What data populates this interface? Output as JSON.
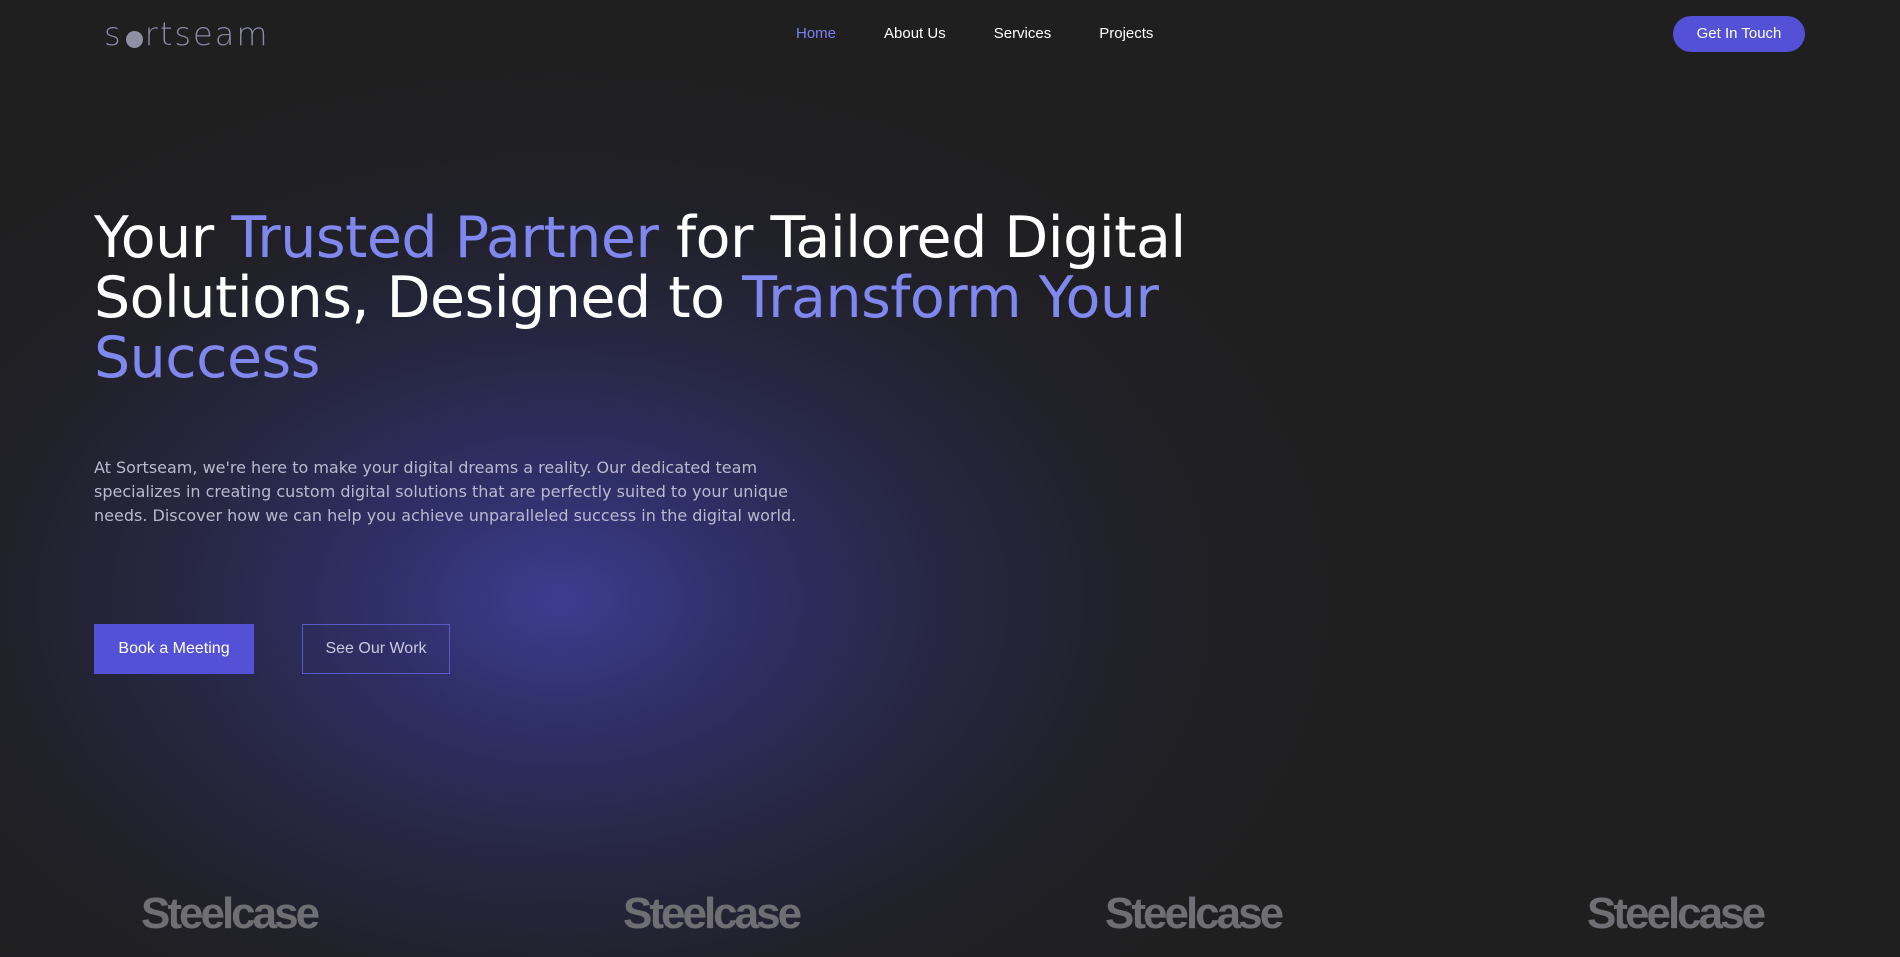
{
  "brand": {
    "logo_prefix": "s",
    "logo_suffix": "rtseam",
    "colors": {
      "accent": "#5551d6",
      "highlight": "#8087ee",
      "background": "#1f1f1f"
    }
  },
  "nav": {
    "items": [
      {
        "label": "Home",
        "active": true
      },
      {
        "label": "About Us",
        "active": false
      },
      {
        "label": "Services",
        "active": false
      },
      {
        "label": "Projects",
        "active": false
      }
    ],
    "cta_label": "Get In Touch"
  },
  "hero": {
    "headline_part1": "Your ",
    "headline_highlight1": "Trusted Partner",
    "headline_part2": " for Tailored Digital Solutions, Designed to ",
    "headline_highlight2": "Transform Your Success",
    "intro": "At Sortseam, we're here to make your digital dreams a reality. Our dedicated team specializes in creating custom digital solutions that are perfectly suited to your unique needs. Discover how we can help you achieve unparalleled success in the digital world.",
    "primary_button": "Book a Meeting",
    "secondary_button": "See Our Work"
  },
  "clients": [
    {
      "name": "Steelcase"
    },
    {
      "name": "Steelcase"
    },
    {
      "name": "Steelcase"
    },
    {
      "name": "Steelcase"
    }
  ]
}
